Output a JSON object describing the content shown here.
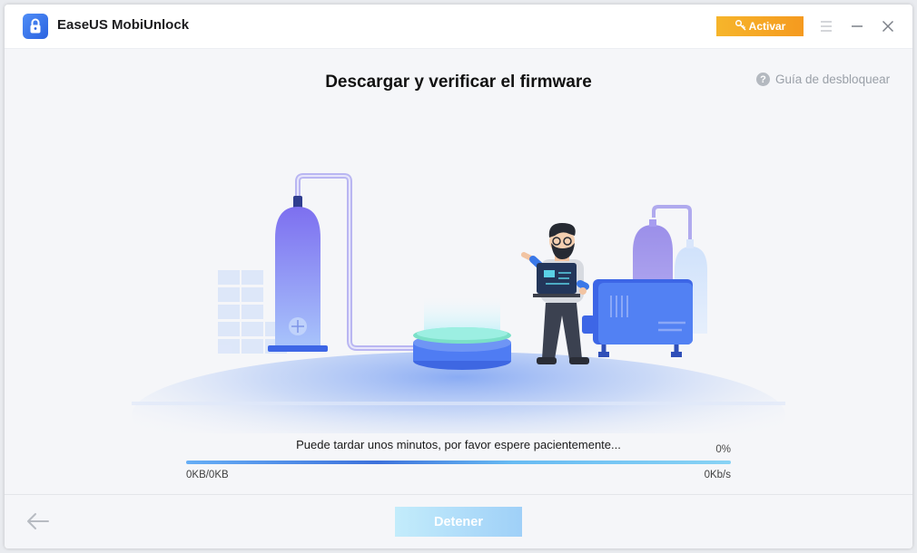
{
  "app": {
    "title": "EaseUS MobiUnlock"
  },
  "header": {
    "activate_label": "Activar",
    "icons": {
      "activate": "key-icon",
      "menu": "menu-icon",
      "minimize": "minimize-icon",
      "close": "close-icon",
      "logo": "lock-logo-icon"
    }
  },
  "main": {
    "title": "Descargar y verificar el firmware",
    "help_label": "Guía de desbloquear",
    "help_icon": "?",
    "status_message": "Puede tardar unos minutos, por favor espere pacientemente...",
    "progress": {
      "percent_label": "0%",
      "fraction": 0.0
    },
    "size_label": "0KB/0KB",
    "speed_label": "0Kb/s"
  },
  "footer": {
    "stop_label": "Detener",
    "back_icon": "arrow-left-icon"
  },
  "colors": {
    "accent": "#2e7cf6",
    "activate": "#f6a623",
    "stop_button": "#b2e0fa",
    "illustration_purple": "#8a7ff0",
    "illustration_blue": "#4f7cf3"
  }
}
